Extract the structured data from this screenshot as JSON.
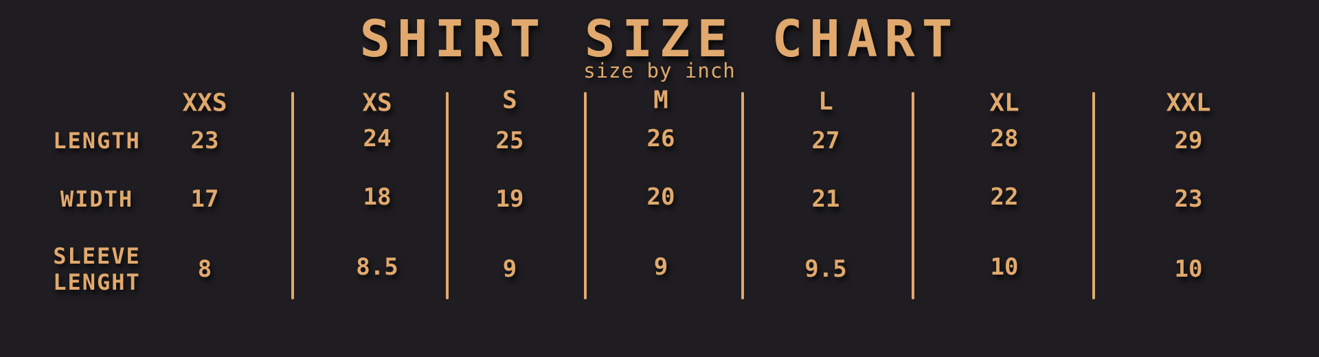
{
  "title": "SHIRT SIZE CHART",
  "subtitle": "size by inch",
  "chart_data": {
    "type": "table",
    "title": "SHIRT SIZE CHART",
    "subtitle": "size by inch",
    "columns": [
      "XXS",
      "XS",
      "S",
      "M",
      "L",
      "XL",
      "XXL"
    ],
    "rows": [
      {
        "label": "LENGTH",
        "values": [
          "23",
          "24",
          "25",
          "26",
          "27",
          "28",
          "29"
        ]
      },
      {
        "label": "WIDTH",
        "values": [
          "17",
          "18",
          "19",
          "20",
          "21",
          "22",
          "23"
        ]
      },
      {
        "label": "SLEEVE LENGHT",
        "label_lines": [
          "SLEEVE",
          "LENGHT"
        ],
        "values": [
          "8",
          "8.5",
          "9",
          "9",
          "9.5",
          "10",
          "10"
        ]
      }
    ]
  },
  "colors": {
    "background": "#1f1d21",
    "accent": "#e1a96d"
  }
}
